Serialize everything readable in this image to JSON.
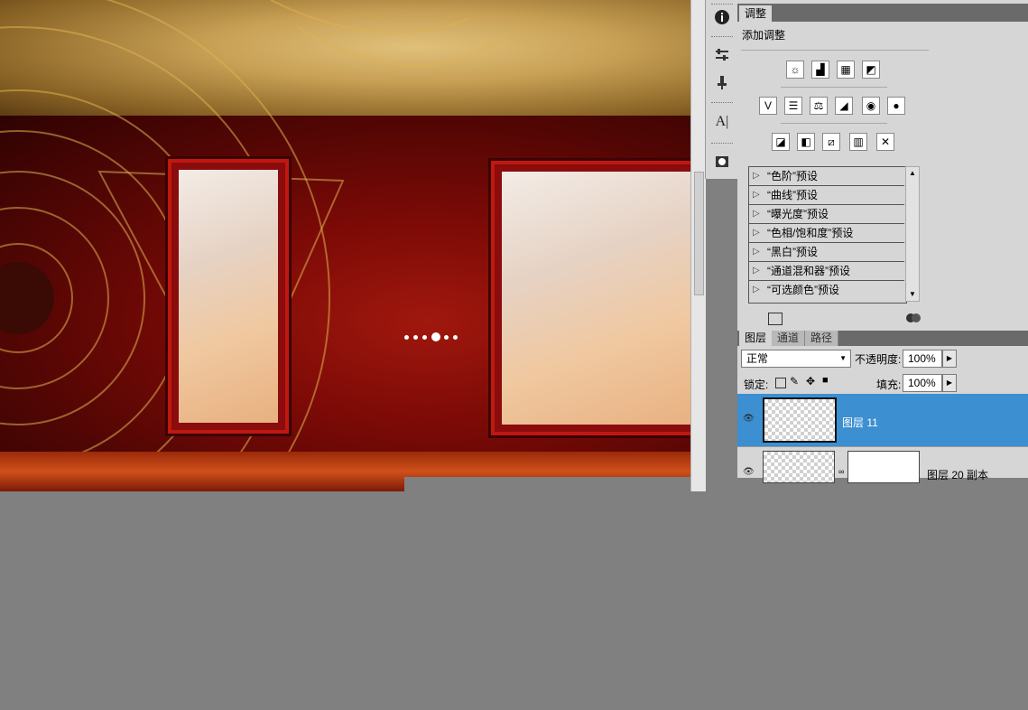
{
  "canvas": {
    "center_mark": "-•-"
  },
  "tools": {
    "info_icon": "info-icon",
    "items": [
      "ℹ",
      "⚙",
      "♆",
      "A|",
      "◘"
    ]
  },
  "adjustments": {
    "tab_label": "调整",
    "heading": "添加调整",
    "icons_row1": [
      "☼",
      "▟",
      "▦",
      "◩"
    ],
    "icons_row2": [
      "V",
      "☰",
      "⚖",
      "◢",
      "◉",
      "●"
    ],
    "icons_row3": [
      "◪",
      "◧",
      "⧄",
      "▥",
      "✕"
    ],
    "presets": [
      "“色阶”预设",
      "“曲线”预设",
      "“曝光度”预设",
      "“色相/饱和度”预设",
      "“黑白”预设",
      "“通道混和器”预设",
      "“可选颜色”预设"
    ]
  },
  "layers": {
    "tabs": [
      "图层",
      "通道",
      "路径"
    ],
    "blend_mode": "正常",
    "opacity_label": "不透明度:",
    "opacity_value": "100%",
    "lock_label": "锁定:",
    "fill_label": "填充:",
    "fill_value": "100%",
    "rows": [
      {
        "name": "图层 11",
        "selected": true
      },
      {
        "name": "图层 20 副本",
        "selected": false
      }
    ]
  },
  "colors": {
    "selection": "#3c8fd0",
    "canvas_red": "#7c0a06",
    "gold": "#c8a055"
  }
}
